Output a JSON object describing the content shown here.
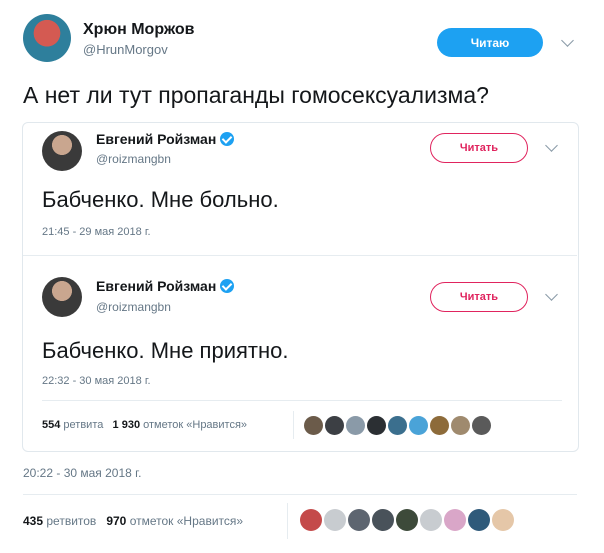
{
  "main_tweet": {
    "author_name": "Хрюн Моржов",
    "author_handle": "@HrunMorgov",
    "follow_label": "Читаю",
    "text": "А нет ли тут пропаганды гомосексуализма?",
    "timestamp": "20:22 - 30 мая 2018 г.",
    "retweets_count": "435",
    "retweets_label": "ретвитов",
    "likes_count": "970",
    "likes_label": "отметок «Нравится»"
  },
  "quoted_tweets": [
    {
      "author_name": "Евгений Ройзман",
      "author_handle": "@roizmangbn",
      "follow_label": "Читать",
      "text": "Бабченко. Мне больно.",
      "timestamp": "21:45 - 29 мая 2018 г."
    },
    {
      "author_name": "Евгений Ройзман",
      "author_handle": "@roizmangbn",
      "follow_label": "Читать",
      "text": "Бабченко. Мне приятно.",
      "timestamp": "22:32 - 30 мая 2018 г.",
      "retweets_count": "554",
      "retweets_label": "ретвита",
      "likes_count": "1 930",
      "likes_label": "отметок «Нравится»"
    }
  ],
  "colors": {
    "twitter_blue": "#1da1f2",
    "follow_red": "#e0245e",
    "text_dark": "#14171a",
    "text_gray": "#657786"
  }
}
